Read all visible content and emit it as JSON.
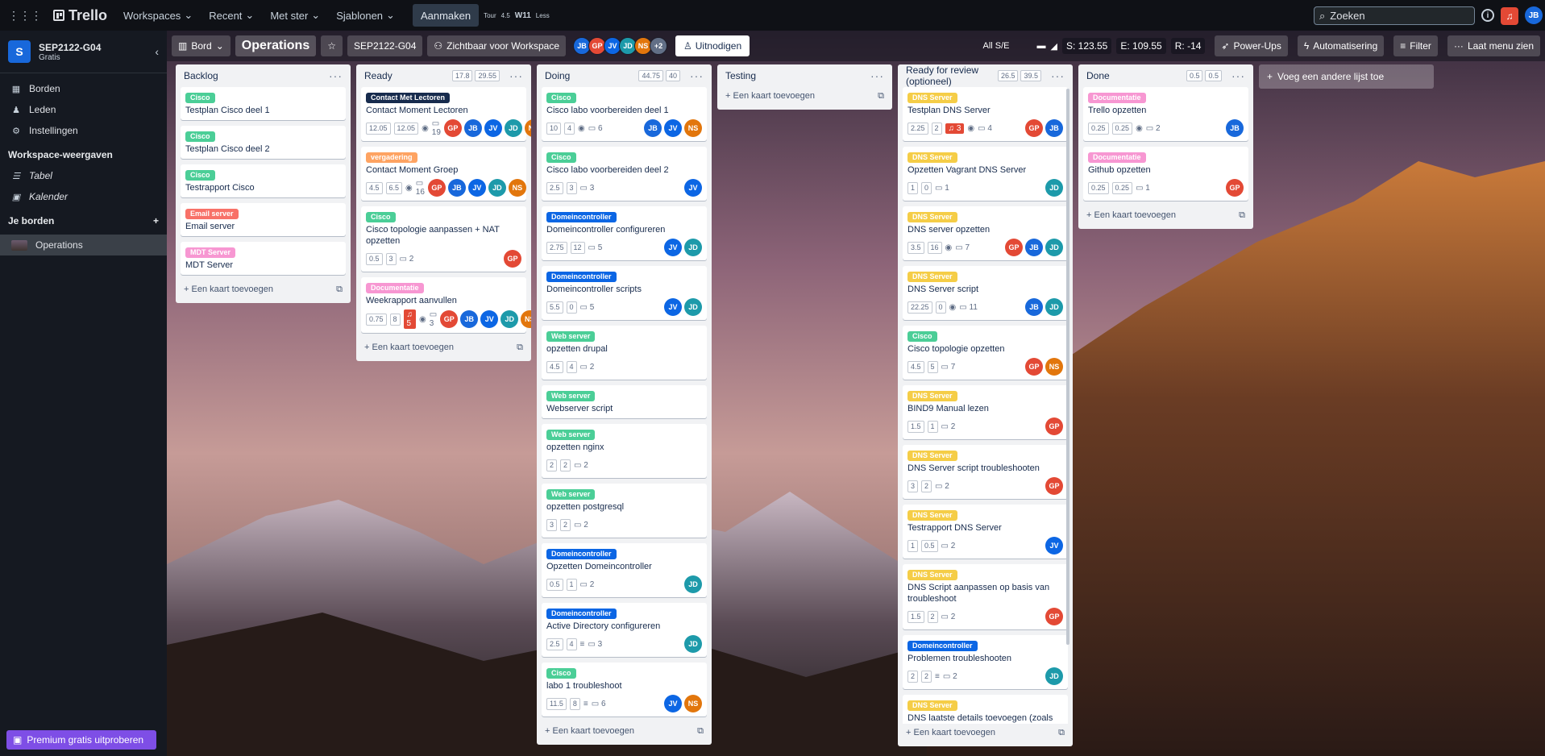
{
  "topbar": {
    "brand": "Trello",
    "nav": [
      "Workspaces",
      "Recent",
      "Met ster",
      "Sjablonen"
    ],
    "create": "Aanmaken",
    "ext": {
      "tour": "Tour",
      "val": "4.5",
      "w": "W11",
      "less": "Less"
    },
    "search": "Zoeken",
    "user_initials": "JB"
  },
  "sidebar": {
    "workspace_name": "SEP2122-G04",
    "workspace_initial": "S",
    "plan": "Gratis",
    "items": [
      {
        "icon": "board-icon",
        "label": "Borden"
      },
      {
        "icon": "members-icon",
        "label": "Leden"
      },
      {
        "icon": "gear-icon",
        "label": "Instellingen"
      }
    ],
    "views_heading": "Workspace-weergaven",
    "views": [
      {
        "icon": "table-icon",
        "label": "Tabel"
      },
      {
        "icon": "calendar-icon",
        "label": "Kalender"
      }
    ],
    "boards_heading": "Je borden",
    "boards": [
      "Operations"
    ],
    "premium": "Premium gratis uitproberen"
  },
  "boardbar": {
    "view": "Bord",
    "title": "Operations",
    "workspace": "SEP2122-G04",
    "visibility": "Zichtbaar voor Workspace",
    "members": [
      "JB",
      "GP",
      "JV",
      "JD",
      "NS"
    ],
    "more_members": "+2",
    "invite": "Uitnodigen",
    "allse": "All S/E",
    "stats": {
      "s": "S: 123.55",
      "e": "E: 109.55",
      "r": "R: -14"
    },
    "powerups": "Power-Ups",
    "automation": "Automatisering",
    "filter": "Filter",
    "menu": "Laat menu zien"
  },
  "add_card": "Een kaart toevoegen",
  "add_list": "Voeg een andere lijst toe",
  "label_colors": {
    "Cisco": "#4bce97",
    "Email server": "#f87168",
    "MDT Server": "#f797d2",
    "Contact Met Lectoren": "#172b4d",
    "vergadering": "#fea362",
    "Documentatie": "#f797d2",
    "Domeincontroller": "#0c66e4",
    "Web server": "#4bce97",
    "DNS Server": "#f5cd47"
  },
  "lists": [
    {
      "title": "Backlog",
      "est": [],
      "cards": [
        {
          "label": "Cisco",
          "title": "Testplan Cisco deel 1"
        },
        {
          "label": "Cisco",
          "title": "Testplan Cisco deel 2"
        },
        {
          "label": "Cisco",
          "title": "Testrapport Cisco"
        },
        {
          "label": "Email server",
          "title": "Email server"
        },
        {
          "label": "MDT Server",
          "title": "MDT Server"
        }
      ]
    },
    {
      "title": "Ready",
      "est": [
        "17.8",
        "29.55"
      ],
      "cards": [
        {
          "label": "Contact Met Lectoren",
          "title": "Contact Moment Lectoren",
          "est": [
            "12.05",
            "12.05"
          ],
          "eye": true,
          "comments": "19",
          "members": [
            "GP",
            "JB",
            "JV",
            "JD",
            "NS"
          ]
        },
        {
          "label": "vergadering",
          "title": "Contact Moment Groep",
          "est": [
            "4.5",
            "6.5"
          ],
          "eye": true,
          "comments": "16",
          "members": [
            "GP",
            "JB",
            "JV",
            "JD",
            "NS"
          ]
        },
        {
          "label": "Cisco",
          "title": "Cisco topologie aanpassen + NAT opzetten",
          "est": [
            "0.5",
            "3"
          ],
          "comments": "2",
          "members": [
            "GP"
          ]
        },
        {
          "label": "Documentatie",
          "title": "Weekrapport aanvullen",
          "est": [
            "0.75",
            "8"
          ],
          "alert": "5",
          "eye": true,
          "comments": "3",
          "members": [
            "GP",
            "JB",
            "JV",
            "JD",
            "NS"
          ]
        }
      ]
    },
    {
      "title": "Doing",
      "est": [
        "44.75",
        "40"
      ],
      "cards": [
        {
          "label": "Cisco",
          "title": "Cisco labo voorbereiden deel 1",
          "est": [
            "10",
            "4"
          ],
          "eye": true,
          "comments": "6",
          "members": [
            "JB",
            "JV",
            "NS"
          ]
        },
        {
          "label": "Cisco",
          "title": "Cisco labo voorbereiden deel 2",
          "est": [
            "2.5",
            "3"
          ],
          "comments": "3",
          "members": [
            "JV"
          ]
        },
        {
          "label": "Domeincontroller",
          "title": "Domeincontroller configureren",
          "est": [
            "2.75",
            "12"
          ],
          "comments": "5",
          "members": [
            "JV",
            "JD"
          ]
        },
        {
          "label": "Domeincontroller",
          "title": "Domeincontroller scripts",
          "est": [
            "5.5",
            "0"
          ],
          "comments": "5",
          "members": [
            "JV",
            "JD"
          ]
        },
        {
          "label": "Web server",
          "title": "opzetten drupal",
          "est": [
            "4.5",
            "4"
          ],
          "comments": "2",
          "members": []
        },
        {
          "label": "Web server",
          "title": "Webserver script",
          "members": []
        },
        {
          "label": "Web server",
          "title": "opzetten nginx",
          "est": [
            "2",
            "2"
          ],
          "comments": "2",
          "members": []
        },
        {
          "label": "Web server",
          "title": "opzetten postgresql",
          "est": [
            "3",
            "2"
          ],
          "comments": "2",
          "members": []
        },
        {
          "label": "Domeincontroller",
          "title": "Opzetten Domeincontroller",
          "est": [
            "0.5",
            "1"
          ],
          "comments": "2",
          "members": [
            "JD"
          ]
        },
        {
          "label": "Domeincontroller",
          "title": "Active Directory configureren",
          "est": [
            "2.5",
            "4"
          ],
          "desc": true,
          "comments": "3",
          "members": [
            "JD"
          ]
        },
        {
          "label": "Cisco",
          "title": "labo 1 troubleshoot",
          "est": [
            "11.5",
            "8"
          ],
          "desc": true,
          "comments": "6",
          "members": [
            "JV",
            "NS"
          ]
        }
      ]
    },
    {
      "title": "Testing",
      "est": [],
      "cards": []
    },
    {
      "title": "Ready for review (optioneel)",
      "est": [
        "26.5",
        "39.5"
      ],
      "cards": [
        {
          "label": "DNS Server",
          "title": "Testplan DNS Server",
          "est": [
            "2.25",
            "2"
          ],
          "alert": "3",
          "eye": true,
          "comments": "4",
          "members": [
            "GP",
            "JB"
          ]
        },
        {
          "label": "DNS Server",
          "title": "Opzetten Vagrant DNS Server",
          "est": [
            "1",
            "0"
          ],
          "comments": "1",
          "members": [
            "JD"
          ]
        },
        {
          "label": "DNS Server",
          "title": "DNS server opzetten",
          "est": [
            "3.5",
            "16"
          ],
          "eye": true,
          "comments": "7",
          "members": [
            "GP",
            "JB",
            "JD"
          ]
        },
        {
          "label": "DNS Server",
          "title": "DNS Server script",
          "est": [
            "22.25",
            "0"
          ],
          "eye": true,
          "comments": "11",
          "members": [
            "JB",
            "JD"
          ]
        },
        {
          "label": "Cisco",
          "title": "Cisco topologie opzetten",
          "est": [
            "4.5",
            "5"
          ],
          "comments": "7",
          "members": [
            "GP",
            "NS"
          ]
        },
        {
          "label": "DNS Server",
          "title": "BIND9 Manual lezen",
          "est": [
            "1.5",
            "1"
          ],
          "comments": "2",
          "members": [
            "GP"
          ]
        },
        {
          "label": "DNS Server",
          "title": "DNS Server script troubleshooten",
          "est": [
            "3",
            "2"
          ],
          "comments": "2",
          "members": [
            "GP"
          ]
        },
        {
          "label": "DNS Server",
          "title": "Testrapport DNS Server",
          "est": [
            "1",
            "0.5"
          ],
          "comments": "2",
          "members": [
            "JV"
          ]
        },
        {
          "label": "DNS Server",
          "title": "DNS Script aanpassen op basis van troubleshoot",
          "est": [
            "1.5",
            "2"
          ],
          "comments": "2",
          "members": [
            "GP"
          ]
        },
        {
          "label": "Domeincontroller",
          "title": "Problemen troubleshooten",
          "est": [
            "2",
            "2"
          ],
          "desc": true,
          "comments": "2",
          "members": [
            "JD"
          ]
        },
        {
          "label": "DNS Server",
          "title": "DNS laatste details toevoegen (zoals",
          "members": []
        }
      ]
    },
    {
      "title": "Done",
      "est": [
        "0.5",
        "0.5"
      ],
      "cards": [
        {
          "label": "Documentatie",
          "title": "Trello opzetten",
          "est": [
            "0.25",
            "0.25"
          ],
          "eye": true,
          "comments": "2",
          "members": [
            "JB"
          ]
        },
        {
          "label": "Documentatie",
          "title": "Github opzetten",
          "est": [
            "0.25",
            "0.25"
          ],
          "comments": "1",
          "members": [
            "GP"
          ]
        }
      ]
    }
  ]
}
